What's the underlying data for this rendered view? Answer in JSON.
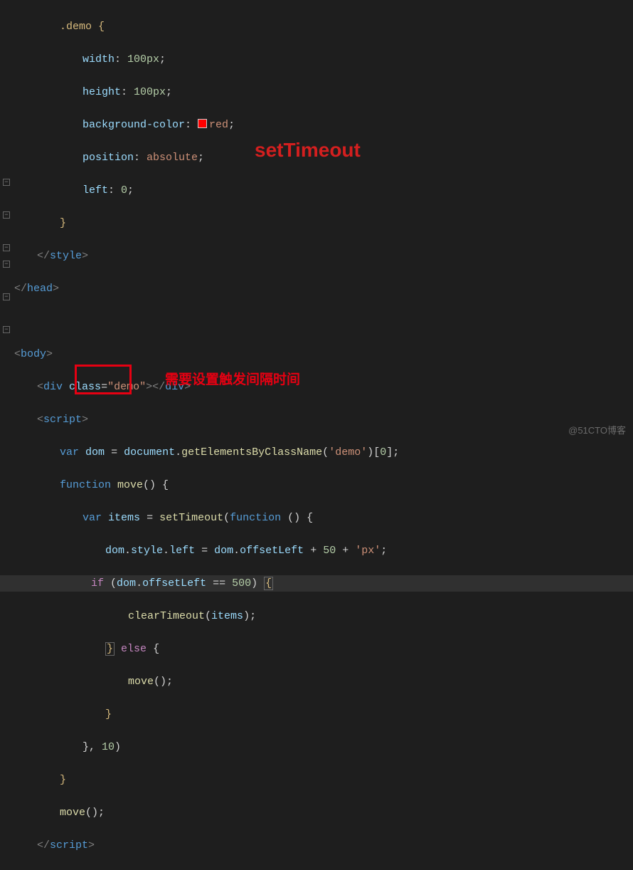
{
  "css": {
    "selector": ".demo {",
    "width_prop": "width",
    "width_val": "100px",
    "height_prop": "height",
    "height_val": "100px",
    "bgcolor_prop": "background-color",
    "bgcolor_val": "red",
    "position_prop": "position",
    "position_val": "absolute",
    "left_prop": "left",
    "left_val": "0"
  },
  "tags": {
    "style_close": "style",
    "head_close": "head",
    "body_open": "body",
    "div": "div",
    "class_attr": "class",
    "class_val": "\"demo\"",
    "script": "script"
  },
  "js": {
    "var_kw": "var",
    "dom_var": "dom",
    "document": "document",
    "getElements": "getElementsByClassName",
    "demo_str": "'demo'",
    "idx0": "0",
    "function_kw": "function",
    "move_fn": "move",
    "items_var": "items",
    "setTimeout": "setTimeout",
    "anon_fn": "function",
    "style": "style",
    "left": "left",
    "offsetLeft": "offsetLeft",
    "fifty": "50",
    "px_str": "'px'",
    "if_kw": "if",
    "eq500": "500",
    "clearTimeout": "clearTimeout",
    "else_kw": "else",
    "delay": "10"
  },
  "overlay": {
    "title": "setTimeout",
    "annotation": "需要设置触发间隔时间",
    "watermark": "@51CTO博客"
  }
}
